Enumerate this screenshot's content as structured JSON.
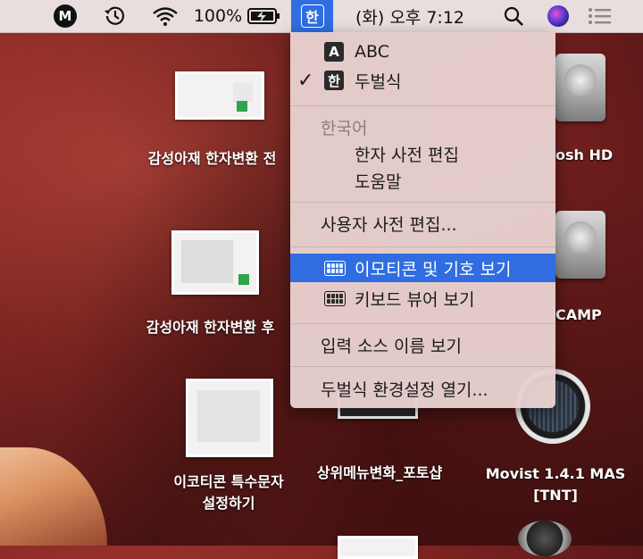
{
  "menubar": {
    "battery_text": "100%",
    "input_source_glyph": "한",
    "datetime": "(화) 오후 7:12",
    "icons": [
      "m-app-icon",
      "time-machine-icon",
      "wifi-icon",
      "battery-charging-icon",
      "input-source-icon",
      "spotlight-search-icon",
      "siri-icon",
      "notification-center-icon"
    ],
    "accent_color": "#2f6de0"
  },
  "menu": {
    "abc_badge": "A",
    "abc_label": "ABC",
    "dubeol_badge": "한",
    "dubeol_label": "두벌식",
    "checkmark": "✓",
    "section_korean": "한국어",
    "hanja_dict": "한자 사전 편집",
    "help": "도움말",
    "user_dict": "사용자 사전 편집...",
    "emoji_symbols": "이모티콘 및 기호 보기",
    "keyboard_viewer": "키보드 뷰어 보기",
    "show_input_name": "입력 소스 이름 보기",
    "open_prefs": "두벌식 환경설정 열기..."
  },
  "desktop": {
    "file1": "감성아재 한자변환 전",
    "file2": "감성아재 한자변환 후",
    "file3_line1": "이코티콘 특수문자",
    "file3_line2": "설정하기",
    "file4": "상위메뉴변화_포토샵",
    "hdd1": "osh HD",
    "hdd2": "CAMP",
    "movist_line1": "Movist 1.4.1 MAS",
    "movist_line2": "[TNT]"
  }
}
